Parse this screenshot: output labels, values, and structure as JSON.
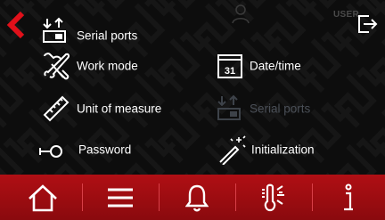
{
  "header": {
    "user_label": "USER"
  },
  "menu": {
    "serial_ports": "Serial ports",
    "work_mode": "Work mode",
    "date_time": "Date/time",
    "date_icon_number": "31",
    "unit_of_measure": "Unit of measure",
    "serial_ports_disabled": "Serial ports",
    "password": "Password",
    "initialization": "Initialization"
  },
  "colors": {
    "accent": "#e0101a",
    "bottom_bar": "#a00c12",
    "disabled_text": "#4a4f57",
    "background": "#0d0d0d"
  },
  "icons": {
    "back": "chevron-left-icon",
    "user": "user-icon",
    "logout": "logout-icon",
    "home": "home-icon",
    "menu": "hamburger-icon",
    "alarm": "bell-icon",
    "temperature": "thermometer-icon",
    "info": "info-icon"
  }
}
